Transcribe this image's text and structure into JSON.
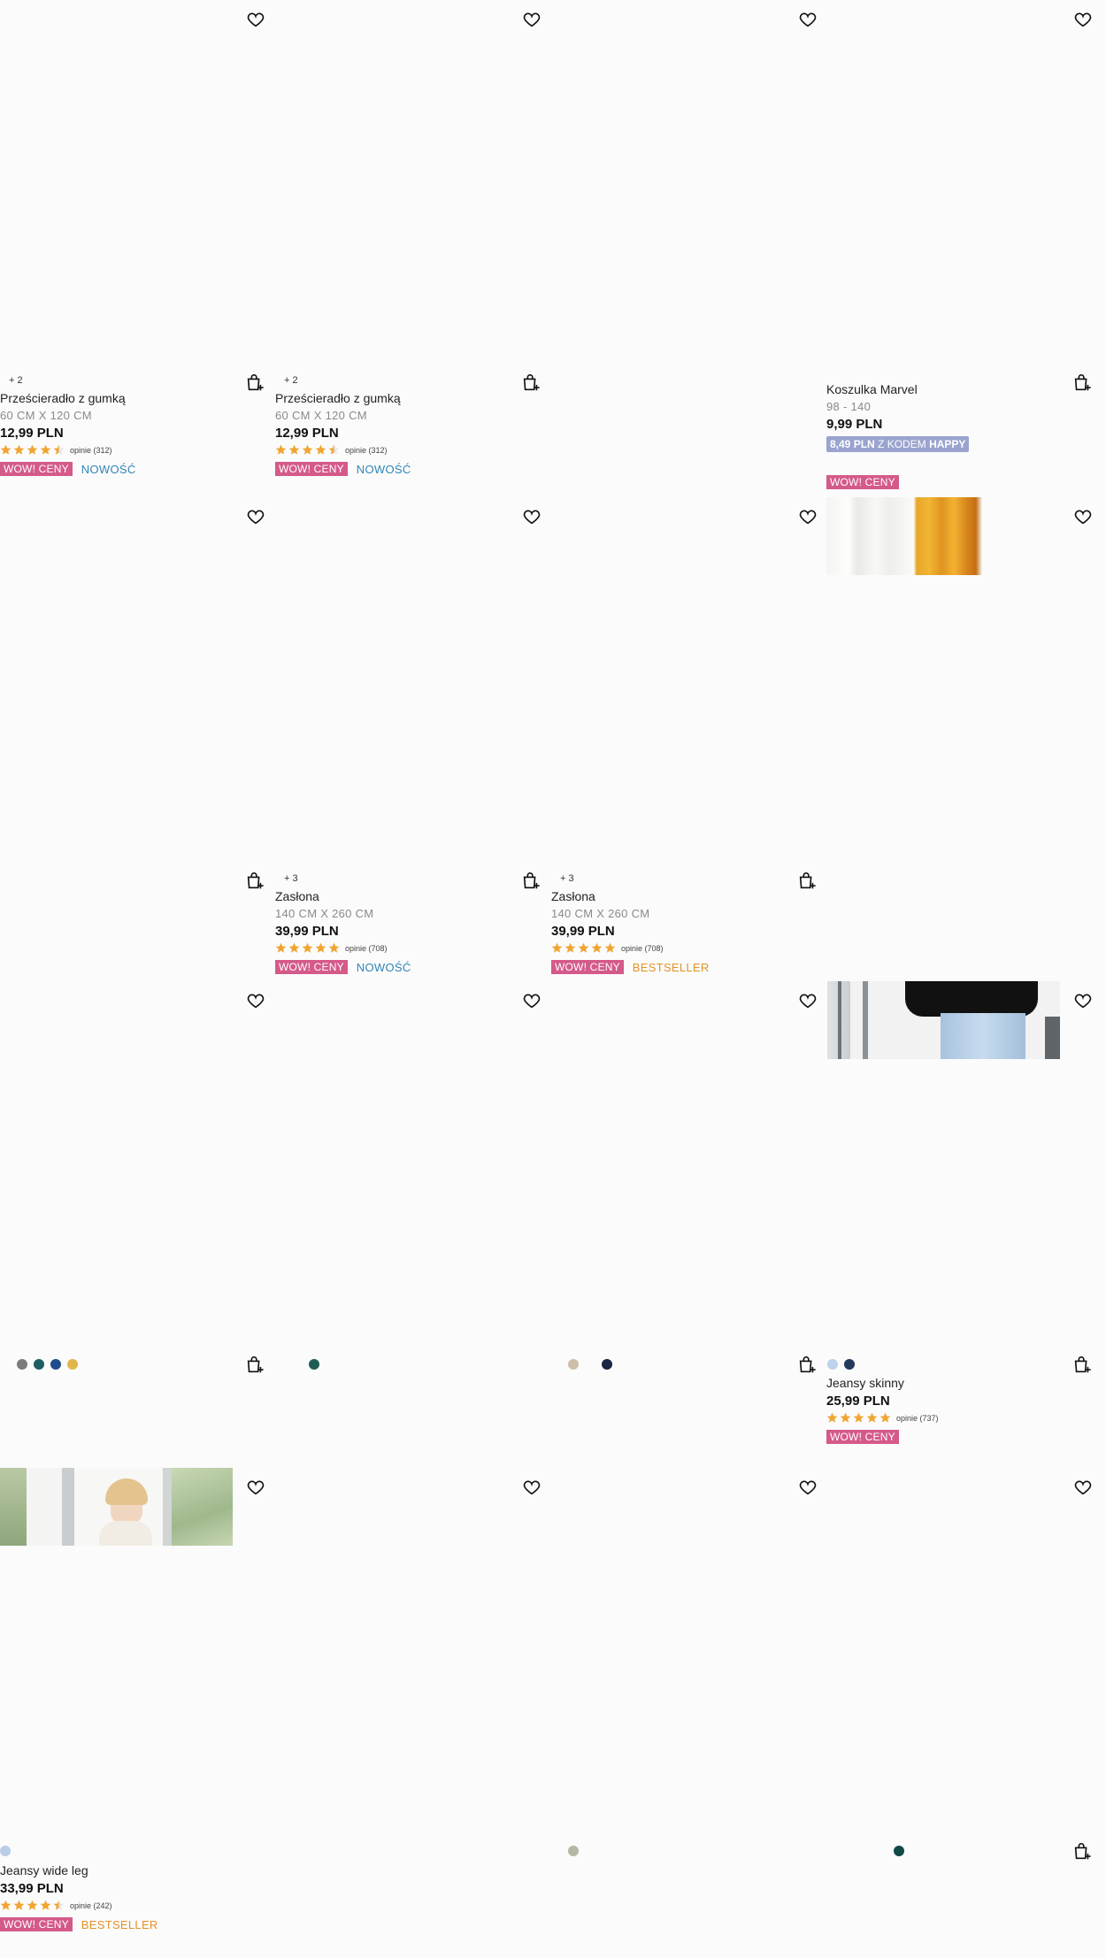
{
  "common": {
    "wow_label": "WOW! CENY",
    "new_label": "NOWOŚĆ",
    "best_label": "BESTSELLER",
    "reviews_prefix": "opinie"
  },
  "colors": {
    "wow_badge": "#d45a8a",
    "new_text": "#2e86b8",
    "bestseller_text": "#e39228",
    "coupon_bg": "#9aa4cf",
    "star": "#f0a531"
  },
  "row1": {
    "p1": {
      "more": "+ 2",
      "name": "Prześcieradło z gumką",
      "size": "60 CM X 120 CM",
      "price": "12,99 PLN",
      "rating": 4.5,
      "reviews": "opinie (312)"
    },
    "p2": {
      "more": "+ 2",
      "name": "Prześcieradło z gumką",
      "size": "60 CM X 120 CM",
      "price": "12,99 PLN",
      "rating": 4.5,
      "reviews": "opinie (312)"
    },
    "p4": {
      "name": "Koszulka Marvel",
      "size": "98 - 140",
      "price": "9,99 PLN",
      "coupon_price": "8,49 PLN",
      "coupon_text": "Z KODEM",
      "coupon_code": "HAPPY"
    }
  },
  "row2": {
    "p2": {
      "more": "+ 3",
      "name": "Zasłona",
      "size": "140 CM X 260 CM",
      "price": "39,99 PLN",
      "rating": 5,
      "reviews": "opinie (708)"
    },
    "p3": {
      "more": "+ 3",
      "name": "Zasłona",
      "size": "140 CM X 260 CM",
      "price": "39,99 PLN",
      "rating": 5,
      "reviews": "opinie (708)"
    }
  },
  "row3": {
    "p1_swatches": [
      "#7b7b7b",
      "#1e5e63",
      "#1f4c8c",
      "#e0b64a"
    ],
    "p2_swatches": [
      "#1f5d54"
    ],
    "p3_swatches": [
      "#cdbfa8",
      "#1b2442"
    ],
    "p4_swatches": [
      "#bcd3ea",
      "#24395c"
    ],
    "p4": {
      "name": "Jeansy skinny",
      "price": "25,99 PLN",
      "rating": 5,
      "reviews": "opinie (737)"
    }
  },
  "row4": {
    "p1": {
      "name": "Jeansy wide leg",
      "price": "33,99 PLN",
      "rating": 4.5,
      "reviews": "opinie (242)"
    },
    "p1_swatches": [
      "#b9cde6"
    ],
    "p3_swatches": [
      "#b7b7a6"
    ],
    "p4_swatches": [
      "#0f4a47"
    ]
  }
}
